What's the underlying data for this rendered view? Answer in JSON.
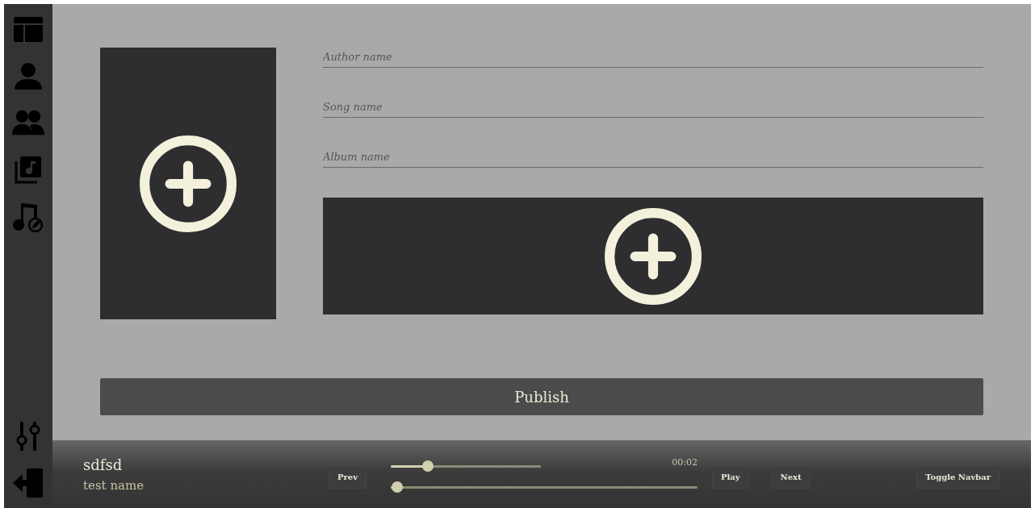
{
  "sidebar": {
    "items": [
      {
        "kind": "layout"
      },
      {
        "kind": "user"
      },
      {
        "kind": "users"
      },
      {
        "kind": "album"
      },
      {
        "kind": "song-edit"
      }
    ],
    "bottom_items": [
      {
        "kind": "sliders"
      },
      {
        "kind": "logout"
      }
    ]
  },
  "form": {
    "fields": [
      {
        "placeholder": "Author name"
      },
      {
        "placeholder": "Song name"
      },
      {
        "placeholder": "Album name"
      }
    ],
    "publish_button": "Publish"
  },
  "player": {
    "title": "sdfsd",
    "artist": "test name",
    "prev": "Prev",
    "play": "Play",
    "next": "Next",
    "toggle": "Toggle Navbar",
    "time": "00:02",
    "volume": {
      "level": 0.25
    },
    "progress": {
      "level": 0.02
    }
  }
}
